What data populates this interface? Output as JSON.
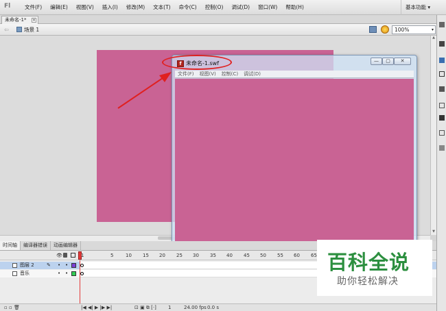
{
  "menubar": {
    "logo": "Fl",
    "items": [
      "文件(F)",
      "编辑(E)",
      "视图(V)",
      "插入(I)",
      "修改(M)",
      "文本(T)",
      "命令(C)",
      "控制(O)",
      "调试(D)",
      "窗口(W)",
      "帮助(H)"
    ],
    "workspace": "基本功能 ▾"
  },
  "document": {
    "tab_label": "未命名-1*",
    "close_glyph": "×"
  },
  "scene": {
    "back_glyph": "⇦",
    "label": "场景 1",
    "zoom": "100%",
    "zoom_arrow": "▾"
  },
  "stage": {
    "color": "#c96394"
  },
  "swf_window": {
    "title": "未命名-1.swf",
    "icon_glyph": "f",
    "min_glyph": "—",
    "max_glyph": "▢",
    "close_glyph": "✕",
    "menu": [
      "文件(F)",
      "视图(V)",
      "控制(C)",
      "调试(D)"
    ]
  },
  "timeline": {
    "tabs": [
      "时间轴",
      "编译器错误",
      "动画编辑器"
    ],
    "eye_glyph": "👁",
    "frame_ticks": [
      "1",
      "5",
      "10",
      "15",
      "20",
      "25",
      "30",
      "35",
      "40",
      "45",
      "50",
      "55",
      "60",
      "65"
    ],
    "layers": [
      {
        "name": "图层 2",
        "pencil": "✎",
        "dot1": "•",
        "dot2": "•",
        "color": "#7b3fd6"
      },
      {
        "name": "音乐",
        "pencil": "",
        "dot1": "•",
        "dot2": "•",
        "color": "#33cc55"
      }
    ],
    "controls": {
      "left_buttons": "▫ ▫ 🗑",
      "playback": "|◀ ◀| ▶ |▶ ▶|",
      "onion": "⊡ ▣ ⧉ [·]",
      "frame": "1",
      "fps": "24.00 fps",
      "time": "0.0 s"
    }
  },
  "watermark": {
    "title": "百科全说",
    "subtitle": "助你轻松解决"
  },
  "colors": {
    "annotation_red": "#e02020",
    "stage_pink": "#c96394"
  }
}
